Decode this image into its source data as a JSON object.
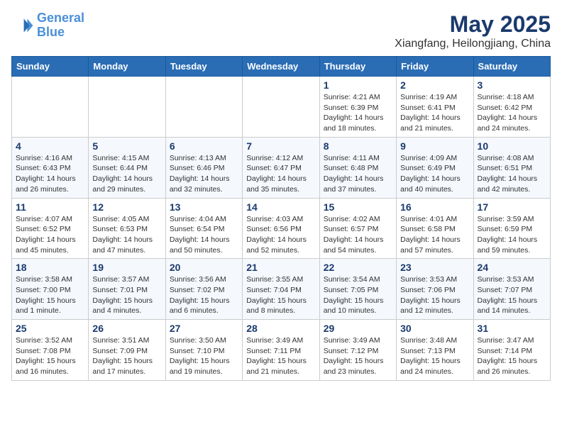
{
  "logo": {
    "line1": "General",
    "line2": "Blue"
  },
  "title": "May 2025",
  "location": "Xiangfang, Heilongjiang, China",
  "days_of_week": [
    "Sunday",
    "Monday",
    "Tuesday",
    "Wednesday",
    "Thursday",
    "Friday",
    "Saturday"
  ],
  "weeks": [
    [
      {
        "day": "",
        "info": ""
      },
      {
        "day": "",
        "info": ""
      },
      {
        "day": "",
        "info": ""
      },
      {
        "day": "",
        "info": ""
      },
      {
        "day": "1",
        "info": "Sunrise: 4:21 AM\nSunset: 6:39 PM\nDaylight: 14 hours\nand 18 minutes."
      },
      {
        "day": "2",
        "info": "Sunrise: 4:19 AM\nSunset: 6:41 PM\nDaylight: 14 hours\nand 21 minutes."
      },
      {
        "day": "3",
        "info": "Sunrise: 4:18 AM\nSunset: 6:42 PM\nDaylight: 14 hours\nand 24 minutes."
      }
    ],
    [
      {
        "day": "4",
        "info": "Sunrise: 4:16 AM\nSunset: 6:43 PM\nDaylight: 14 hours\nand 26 minutes."
      },
      {
        "day": "5",
        "info": "Sunrise: 4:15 AM\nSunset: 6:44 PM\nDaylight: 14 hours\nand 29 minutes."
      },
      {
        "day": "6",
        "info": "Sunrise: 4:13 AM\nSunset: 6:46 PM\nDaylight: 14 hours\nand 32 minutes."
      },
      {
        "day": "7",
        "info": "Sunrise: 4:12 AM\nSunset: 6:47 PM\nDaylight: 14 hours\nand 35 minutes."
      },
      {
        "day": "8",
        "info": "Sunrise: 4:11 AM\nSunset: 6:48 PM\nDaylight: 14 hours\nand 37 minutes."
      },
      {
        "day": "9",
        "info": "Sunrise: 4:09 AM\nSunset: 6:49 PM\nDaylight: 14 hours\nand 40 minutes."
      },
      {
        "day": "10",
        "info": "Sunrise: 4:08 AM\nSunset: 6:51 PM\nDaylight: 14 hours\nand 42 minutes."
      }
    ],
    [
      {
        "day": "11",
        "info": "Sunrise: 4:07 AM\nSunset: 6:52 PM\nDaylight: 14 hours\nand 45 minutes."
      },
      {
        "day": "12",
        "info": "Sunrise: 4:05 AM\nSunset: 6:53 PM\nDaylight: 14 hours\nand 47 minutes."
      },
      {
        "day": "13",
        "info": "Sunrise: 4:04 AM\nSunset: 6:54 PM\nDaylight: 14 hours\nand 50 minutes."
      },
      {
        "day": "14",
        "info": "Sunrise: 4:03 AM\nSunset: 6:56 PM\nDaylight: 14 hours\nand 52 minutes."
      },
      {
        "day": "15",
        "info": "Sunrise: 4:02 AM\nSunset: 6:57 PM\nDaylight: 14 hours\nand 54 minutes."
      },
      {
        "day": "16",
        "info": "Sunrise: 4:01 AM\nSunset: 6:58 PM\nDaylight: 14 hours\nand 57 minutes."
      },
      {
        "day": "17",
        "info": "Sunrise: 3:59 AM\nSunset: 6:59 PM\nDaylight: 14 hours\nand 59 minutes."
      }
    ],
    [
      {
        "day": "18",
        "info": "Sunrise: 3:58 AM\nSunset: 7:00 PM\nDaylight: 15 hours\nand 1 minute."
      },
      {
        "day": "19",
        "info": "Sunrise: 3:57 AM\nSunset: 7:01 PM\nDaylight: 15 hours\nand 4 minutes."
      },
      {
        "day": "20",
        "info": "Sunrise: 3:56 AM\nSunset: 7:02 PM\nDaylight: 15 hours\nand 6 minutes."
      },
      {
        "day": "21",
        "info": "Sunrise: 3:55 AM\nSunset: 7:04 PM\nDaylight: 15 hours\nand 8 minutes."
      },
      {
        "day": "22",
        "info": "Sunrise: 3:54 AM\nSunset: 7:05 PM\nDaylight: 15 hours\nand 10 minutes."
      },
      {
        "day": "23",
        "info": "Sunrise: 3:53 AM\nSunset: 7:06 PM\nDaylight: 15 hours\nand 12 minutes."
      },
      {
        "day": "24",
        "info": "Sunrise: 3:53 AM\nSunset: 7:07 PM\nDaylight: 15 hours\nand 14 minutes."
      }
    ],
    [
      {
        "day": "25",
        "info": "Sunrise: 3:52 AM\nSunset: 7:08 PM\nDaylight: 15 hours\nand 16 minutes."
      },
      {
        "day": "26",
        "info": "Sunrise: 3:51 AM\nSunset: 7:09 PM\nDaylight: 15 hours\nand 17 minutes."
      },
      {
        "day": "27",
        "info": "Sunrise: 3:50 AM\nSunset: 7:10 PM\nDaylight: 15 hours\nand 19 minutes."
      },
      {
        "day": "28",
        "info": "Sunrise: 3:49 AM\nSunset: 7:11 PM\nDaylight: 15 hours\nand 21 minutes."
      },
      {
        "day": "29",
        "info": "Sunrise: 3:49 AM\nSunset: 7:12 PM\nDaylight: 15 hours\nand 23 minutes."
      },
      {
        "day": "30",
        "info": "Sunrise: 3:48 AM\nSunset: 7:13 PM\nDaylight: 15 hours\nand 24 minutes."
      },
      {
        "day": "31",
        "info": "Sunrise: 3:47 AM\nSunset: 7:14 PM\nDaylight: 15 hours\nand 26 minutes."
      }
    ]
  ]
}
